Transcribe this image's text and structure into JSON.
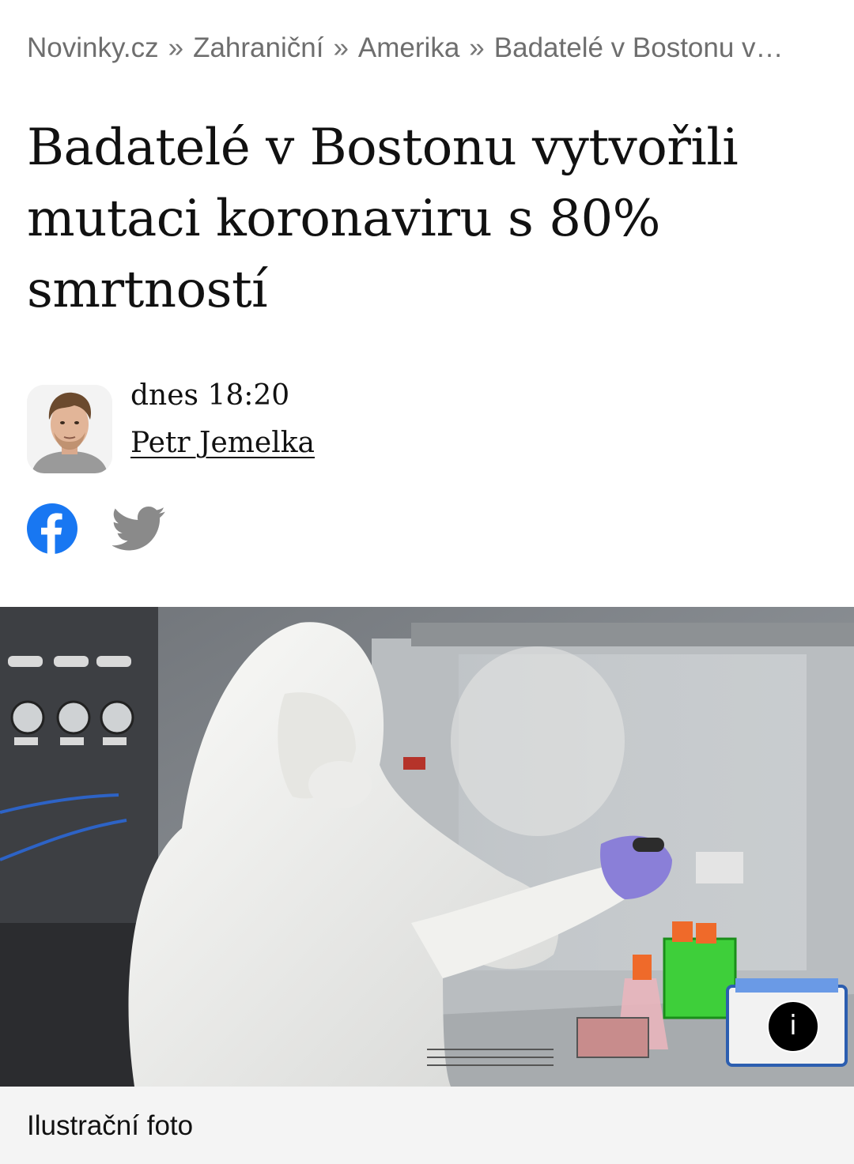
{
  "breadcrumb": {
    "items": [
      "Novinky.cz",
      "Zahraniční",
      "Amerika",
      "Badatelé v Bostonu v…"
    ],
    "separator": "»"
  },
  "article": {
    "title": "Badatelé v Bostonu vytvořili mutaci koronaviru s 80% smrtností",
    "date": "dnes 18:20",
    "author": "Petr Jemelka"
  },
  "share": {
    "icons": [
      "facebook-icon",
      "twitter-icon"
    ],
    "facebook_color": "#1877F2",
    "twitter_color": "#8a8a8a"
  },
  "photo": {
    "info_label": "i",
    "caption": "Ilustrační foto"
  }
}
